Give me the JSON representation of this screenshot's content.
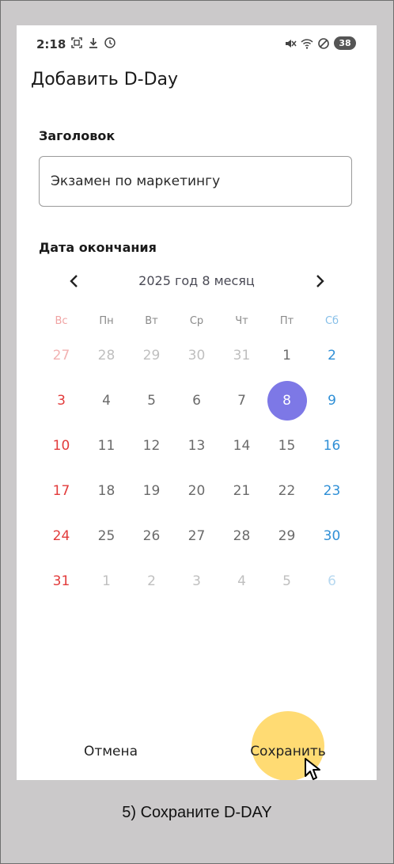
{
  "status_bar": {
    "time": "2:18",
    "battery": "38",
    "left_icons": [
      "screenshot-icon",
      "download-icon",
      "timer-icon"
    ],
    "right_icons": [
      "mute-icon",
      "wifi-icon",
      "do-not-disturb-icon"
    ]
  },
  "screen": {
    "title": "Добавить D-Day",
    "title_label": "Заголовок",
    "title_value": "Экзамен по маркетингу",
    "date_label": "Дата окончания"
  },
  "calendar": {
    "month_label": "2025 год 8 месяц",
    "weekdays": [
      "Вс",
      "Пн",
      "Вт",
      "Ср",
      "Чт",
      "Пт",
      "Сб"
    ],
    "selected_day": "8",
    "weeks": [
      [
        {
          "d": "27",
          "o": true
        },
        {
          "d": "28",
          "o": true
        },
        {
          "d": "29",
          "o": true
        },
        {
          "d": "30",
          "o": true
        },
        {
          "d": "31",
          "o": true
        },
        {
          "d": "1",
          "o": false
        },
        {
          "d": "2",
          "o": false
        }
      ],
      [
        {
          "d": "3",
          "o": false
        },
        {
          "d": "4",
          "o": false
        },
        {
          "d": "5",
          "o": false
        },
        {
          "d": "6",
          "o": false
        },
        {
          "d": "7",
          "o": false
        },
        {
          "d": "8",
          "o": false
        },
        {
          "d": "9",
          "o": false
        }
      ],
      [
        {
          "d": "10",
          "o": false
        },
        {
          "d": "11",
          "o": false
        },
        {
          "d": "12",
          "o": false
        },
        {
          "d": "13",
          "o": false
        },
        {
          "d": "14",
          "o": false
        },
        {
          "d": "15",
          "o": false
        },
        {
          "d": "16",
          "o": false
        }
      ],
      [
        {
          "d": "17",
          "o": false
        },
        {
          "d": "18",
          "o": false
        },
        {
          "d": "19",
          "o": false
        },
        {
          "d": "20",
          "o": false
        },
        {
          "d": "21",
          "o": false
        },
        {
          "d": "22",
          "o": false
        },
        {
          "d": "23",
          "o": false
        }
      ],
      [
        {
          "d": "24",
          "o": false
        },
        {
          "d": "25",
          "o": false
        },
        {
          "d": "26",
          "o": false
        },
        {
          "d": "27",
          "o": false
        },
        {
          "d": "28",
          "o": false
        },
        {
          "d": "29",
          "o": false
        },
        {
          "d": "30",
          "o": false
        }
      ],
      [
        {
          "d": "31",
          "o": false
        },
        {
          "d": "1",
          "o": true
        },
        {
          "d": "2",
          "o": true
        },
        {
          "d": "3",
          "o": true
        },
        {
          "d": "4",
          "o": true
        },
        {
          "d": "5",
          "o": true
        },
        {
          "d": "6",
          "o": true
        }
      ]
    ],
    "colors": {
      "sunday": "#e23b3b",
      "saturday": "#2f8fd6",
      "selected": "#7d78e6"
    }
  },
  "actions": {
    "cancel_label": "Отмена",
    "save_label": "Сохранить",
    "highlight_color": "#ffd96b"
  },
  "caption": "5) Сохраните D-DAY"
}
